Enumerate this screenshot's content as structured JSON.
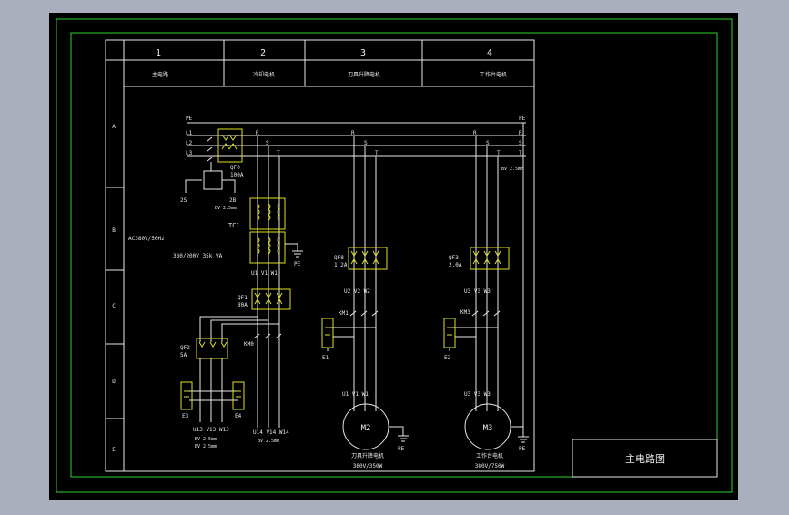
{
  "frame": {
    "columns": [
      "1",
      "2",
      "3",
      "4"
    ],
    "column_titles": [
      "主电路",
      "冷却电机",
      "刀具升降电机",
      "工作台电机"
    ],
    "rows": [
      "A",
      "B",
      "C",
      "D",
      "E"
    ]
  },
  "title_block": {
    "drawing_title": "主电路图"
  },
  "buses": {
    "pe": "PE",
    "r": "R",
    "s": "S",
    "t": "T",
    "l1": "L1",
    "l2": "L2",
    "l3": "L3"
  },
  "components": {
    "qf0": {
      "name": "QF0",
      "rating": "100A"
    },
    "transformer": {
      "name": "TC1",
      "spec": "AC380V/50Hz",
      "spec2": "380/200V  35k VA",
      "terminals": "U1 V1 W1"
    },
    "qf1": {
      "name": "QF1",
      "rating": "80A"
    },
    "qf2": {
      "name": "QF2",
      "rating": "5A"
    },
    "qf8": {
      "name": "QF8",
      "rating": "1.2A"
    },
    "qf3": {
      "name": "QF3",
      "rating": "2.0A"
    },
    "km0": "KM0",
    "km1": "KM1",
    "km3": "KM3",
    "e1": "E1",
    "e2": "E2",
    "e3": "E3",
    "e4": "E4",
    "branch_labels": [
      "2S",
      "2B"
    ],
    "m2": {
      "name": "M2",
      "desc": "刀具升降电机",
      "rating": "380V/350W",
      "terminals": "U1 V1 W1",
      "breaker_out": "U2 V2 W2"
    },
    "m3": {
      "name": "M3",
      "desc": "工作台电机",
      "rating": "380V/750W",
      "terminals": "U3 V3 W3",
      "breaker_out": "U3 V3 W3"
    },
    "bottom_left_terminals": "U13 V13 W13",
    "bottom_mid_terminals": "U14 V14 W14",
    "wire_notes": [
      "BV 2.5mm",
      "BV 2.5mm",
      "BV 2.5mm",
      "BV 2.5mm",
      "BV 2.5mm"
    ]
  }
}
